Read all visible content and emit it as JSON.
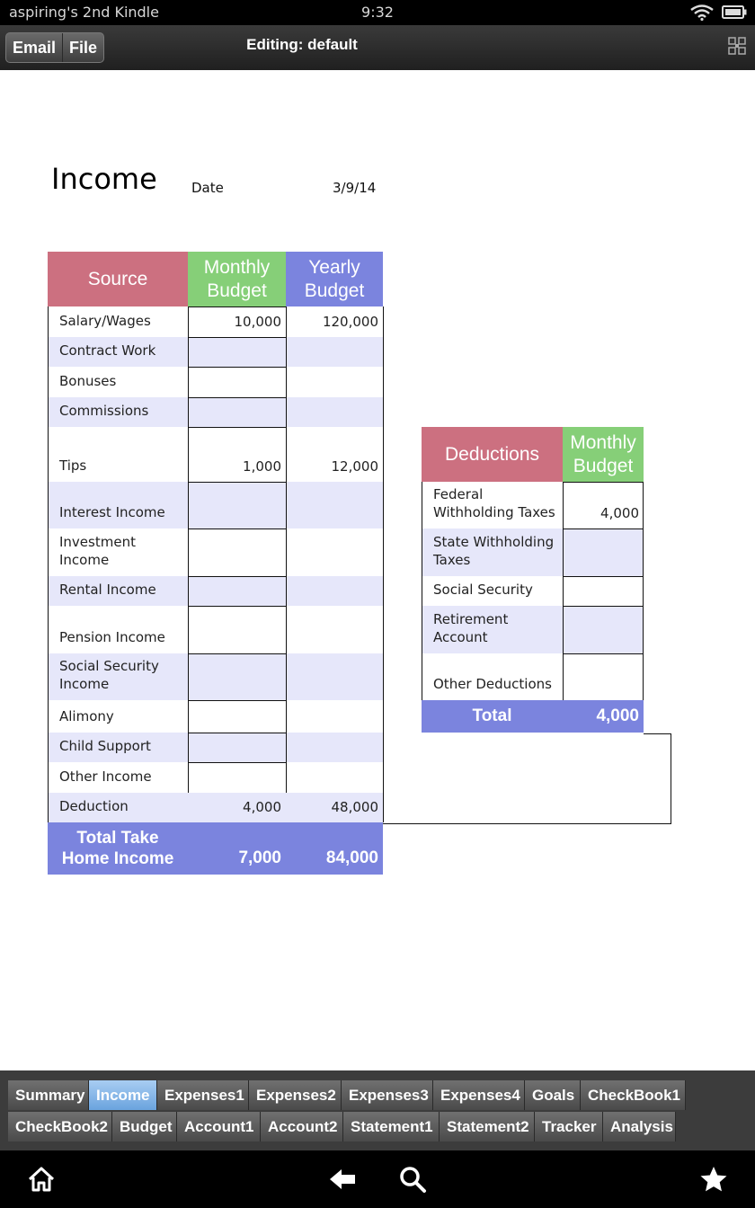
{
  "status_bar": {
    "device_name": "aspiring's 2nd Kindle",
    "time": "9:32"
  },
  "action_bar": {
    "email_label": "Email",
    "file_label": "File",
    "title": "Editing: default"
  },
  "sheet": {
    "title": "Income",
    "date_label": "Date",
    "date_value": "3/9/14",
    "income_table": {
      "headers": {
        "source": "Source",
        "monthly": "Monthly\nBudget",
        "yearly": "Yearly\nBudget"
      },
      "rows": [
        {
          "source": "Salary/Wages",
          "monthly": "10,000",
          "yearly": "120,000"
        },
        {
          "source": "Contract Work",
          "monthly": "",
          "yearly": ""
        },
        {
          "source": "Bonuses",
          "monthly": "",
          "yearly": ""
        },
        {
          "source": "Commissions",
          "monthly": "",
          "yearly": ""
        },
        {
          "source": "Tips",
          "monthly": "1,000",
          "yearly": "12,000"
        },
        {
          "source": "Interest Income",
          "monthly": "",
          "yearly": ""
        },
        {
          "source": "Investment\nIncome",
          "monthly": "",
          "yearly": ""
        },
        {
          "source": "Rental Income",
          "monthly": "",
          "yearly": ""
        },
        {
          "source": "Pension Income",
          "monthly": "",
          "yearly": ""
        },
        {
          "source": "Social Security\nIncome",
          "monthly": "",
          "yearly": ""
        },
        {
          "source": "Alimony",
          "monthly": "",
          "yearly": ""
        },
        {
          "source": "Child Support",
          "monthly": "",
          "yearly": ""
        },
        {
          "source": "Other Income",
          "monthly": "",
          "yearly": ""
        },
        {
          "source": "Deduction",
          "monthly": "4,000",
          "yearly": "48,000"
        }
      ],
      "total": {
        "label": "Total Take\nHome Income",
        "monthly": "7,000",
        "yearly": "84,000"
      }
    },
    "deductions_table": {
      "headers": {
        "deductions": "Deductions",
        "monthly": "Monthly\nBudget"
      },
      "rows": [
        {
          "label": "Federal\nWithholding Taxes",
          "monthly": "4,000"
        },
        {
          "label": "State Withholding\nTaxes",
          "monthly": ""
        },
        {
          "label": "Social Security",
          "monthly": ""
        },
        {
          "label": "Retirement\nAccount",
          "monthly": ""
        },
        {
          "label": "Other Deductions",
          "monthly": ""
        }
      ],
      "total": {
        "label": "Total",
        "monthly": "4,000"
      }
    }
  },
  "tabs": {
    "row1": [
      "Summary",
      "Income",
      "Expenses1",
      "Expenses2",
      "Expenses3",
      "Expenses4",
      "Goals",
      "CheckBook1"
    ],
    "row2": [
      "CheckBook2",
      "Budget",
      "Account1",
      "Account2",
      "Statement1",
      "Statement2",
      "Tracker",
      "Analysis"
    ],
    "active": "Income"
  },
  "colors": {
    "header_source": "#cc7080",
    "header_monthly": "#86cf78",
    "header_yearly": "#7b84de",
    "band": "#e6e7fa",
    "total": "#7b84de"
  },
  "icons": {
    "home": "home-icon",
    "back": "back-arrow-icon",
    "search": "search-icon",
    "favorite": "star-icon"
  }
}
